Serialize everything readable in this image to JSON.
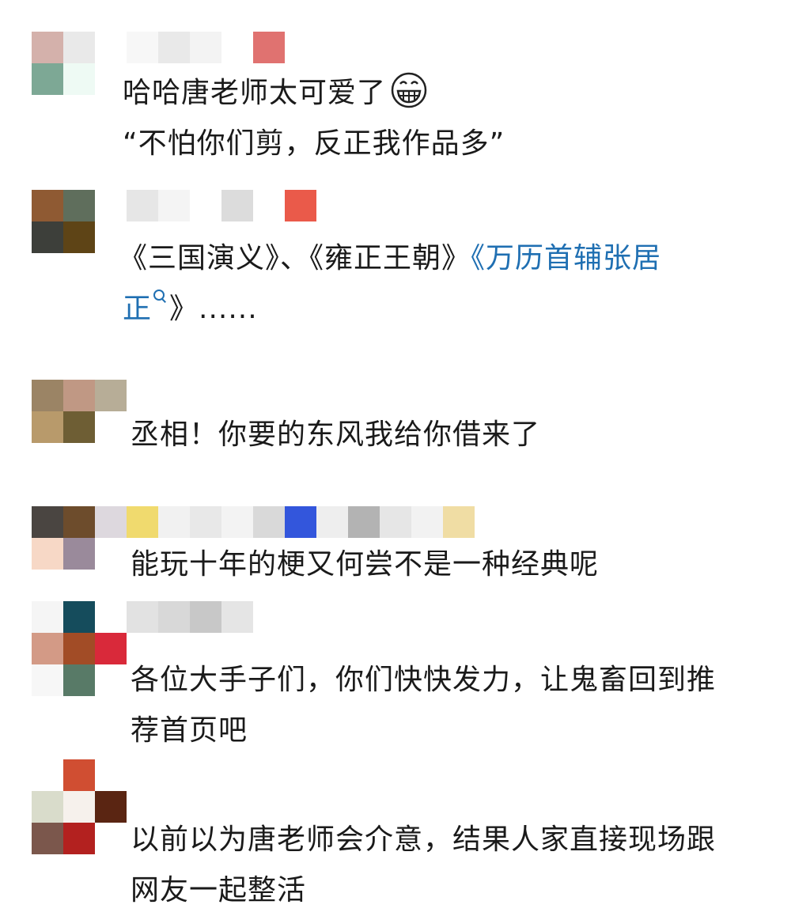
{
  "comments": [
    {
      "lines": [
        "哈哈唐老师太可爱了",
        "“不怕你们剪，反正我作品多”"
      ],
      "emoji": "grinning-face-icon"
    },
    {
      "line1_parts": [
        "《三国演义》、《雍正王朝》",
        "《万历首辅张居"
      ],
      "line2_parts": [
        "正",
        "》......"
      ]
    },
    {
      "lines": [
        "丞相！你要的东风我给你借来了"
      ]
    },
    {
      "lines": [
        "能玩十年的梗又何尝不是一种经典呢"
      ]
    },
    {
      "lines": [
        "各位大手子们，你们快快发力，让鬼畜回到推",
        "荐首页吧"
      ]
    },
    {
      "lines": [
        "以前以为唐老师会介意，结果人家直接现场跟",
        "网友一起整活"
      ]
    }
  ],
  "colors": {
    "text": "#1a1a1a",
    "link": "#1f6fb2",
    "background": "#ffffff"
  }
}
